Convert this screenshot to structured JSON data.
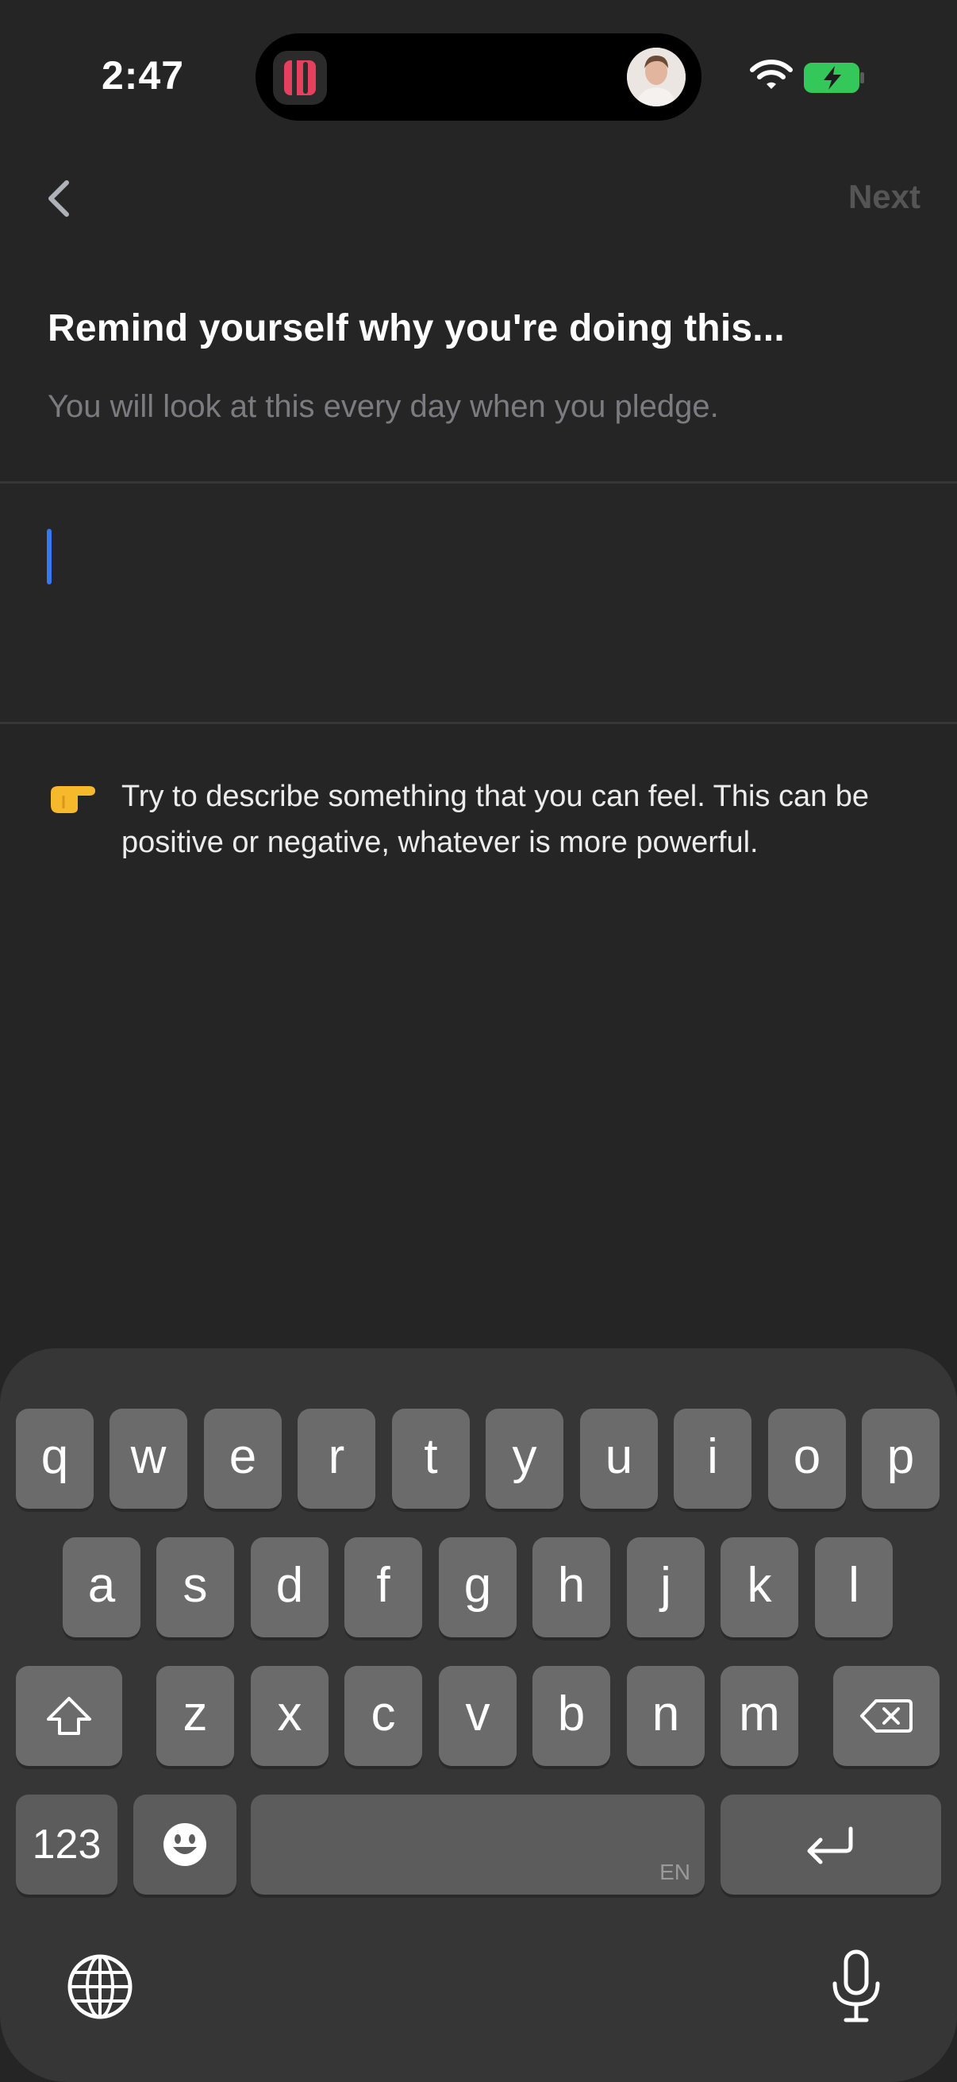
{
  "status_bar": {
    "time": "2:47"
  },
  "header": {
    "back_label": "‹",
    "next_label": "Next"
  },
  "prompt": {
    "title": "Remind yourself why you're doing this...",
    "subtitle": "You will look at this every day when you pledge."
  },
  "input": {
    "value": "",
    "placeholder": ""
  },
  "hint": {
    "emoji": "👉",
    "text": "Try to describe something that you can feel. This can be positive or negative, whatever is more powerful."
  },
  "keyboard": {
    "row1": [
      "q",
      "w",
      "e",
      "r",
      "t",
      "y",
      "u",
      "i",
      "o",
      "p"
    ],
    "row2": [
      "a",
      "s",
      "d",
      "f",
      "g",
      "h",
      "j",
      "k",
      "l"
    ],
    "row3": [
      "z",
      "x",
      "c",
      "v",
      "b",
      "n",
      "m"
    ],
    "numbers_label": "123",
    "space_lang": "EN"
  },
  "colors": {
    "accent_caret": "#3478f6",
    "battery_green": "#34c759",
    "background": "#252525"
  }
}
